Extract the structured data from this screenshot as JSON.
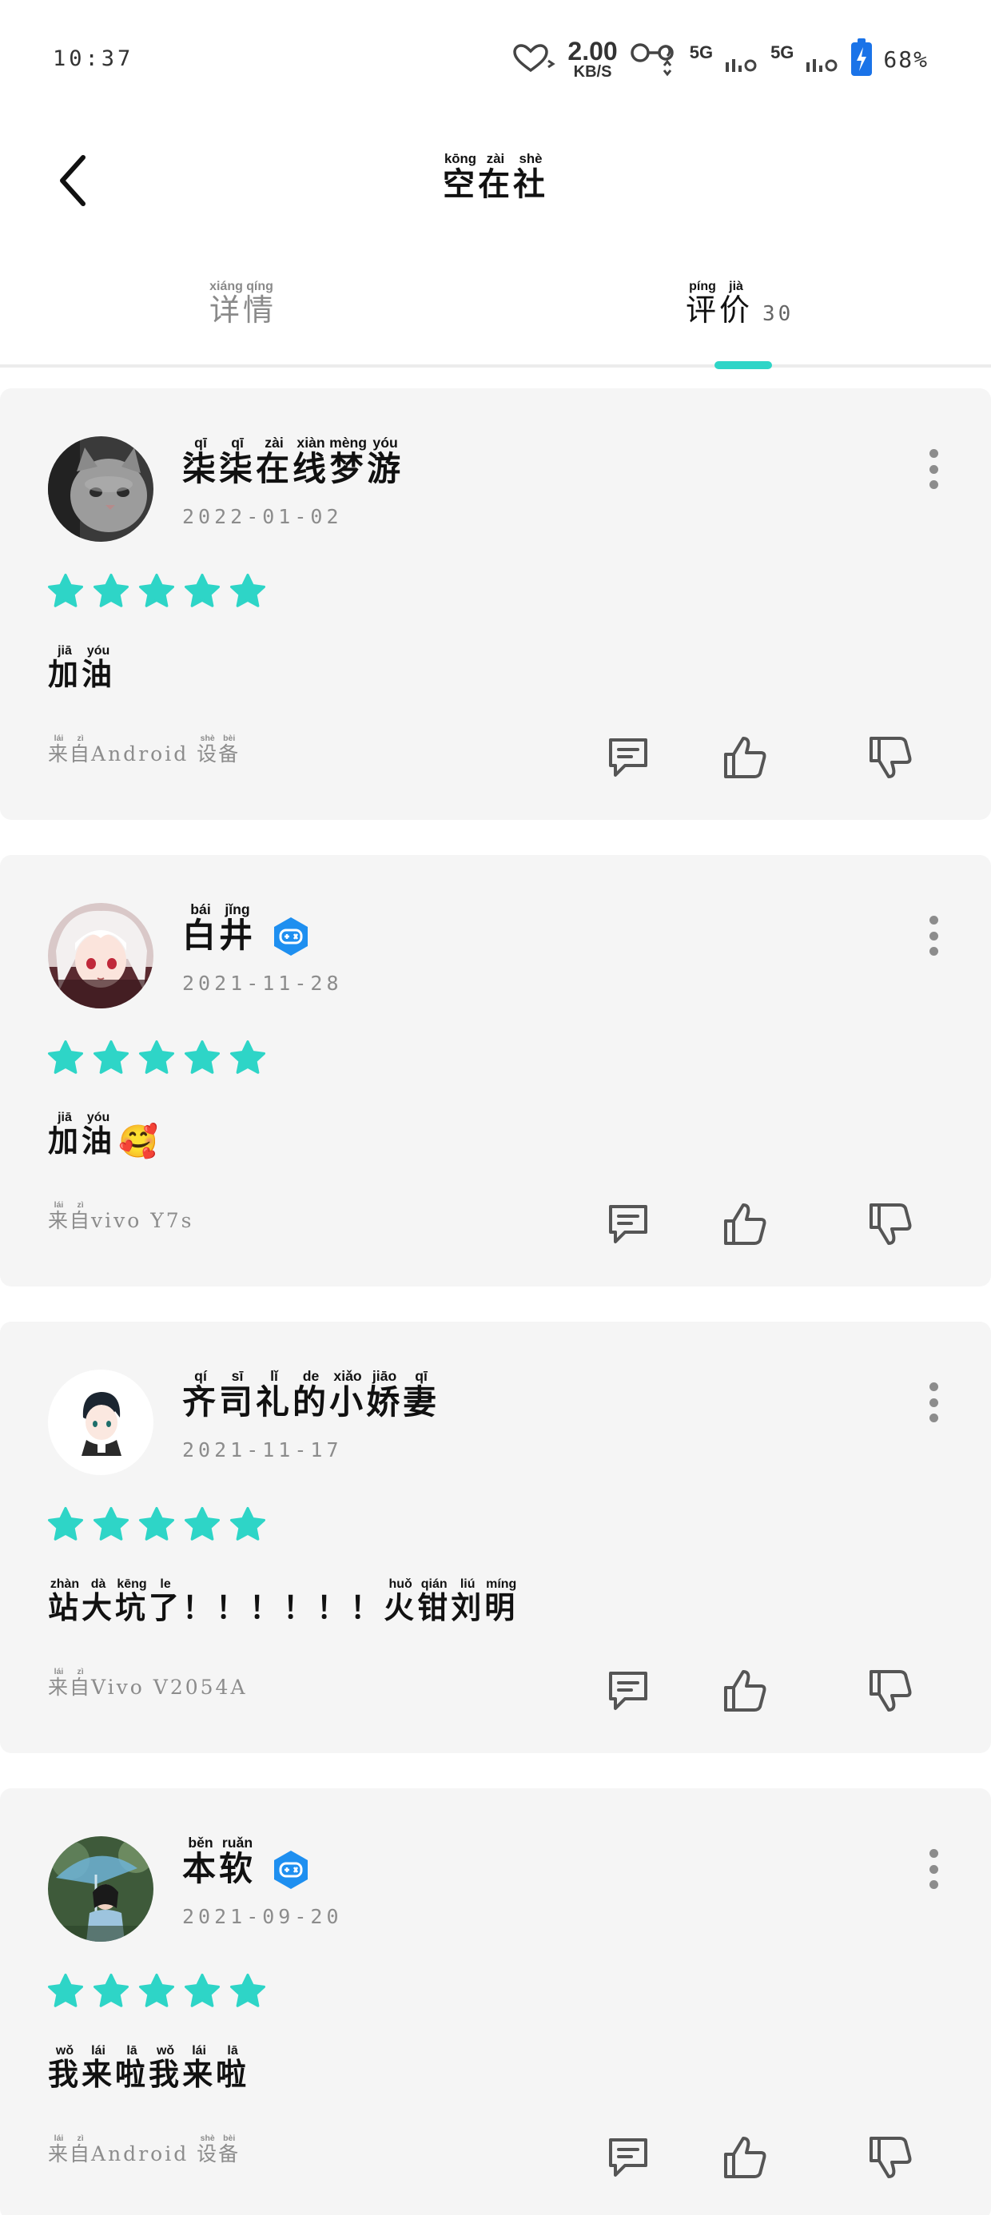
{
  "status_bar": {
    "time": "10:37",
    "speed_value": "2.00",
    "speed_unit": "KB/S",
    "net1": "5G",
    "net2": "5G",
    "battery": "68%"
  },
  "header": {
    "back_icon": "chevron-left-icon",
    "title": [
      {
        "ch": "空",
        "py": "kōng"
      },
      {
        "ch": "在",
        "py": "zài"
      },
      {
        "ch": "社",
        "py": "shè"
      }
    ]
  },
  "tabs": {
    "details": [
      {
        "ch": "详",
        "py": "xiáng"
      },
      {
        "ch": "情",
        "py": "qíng"
      }
    ],
    "reviews": [
      {
        "ch": "评",
        "py": "píng"
      },
      {
        "ch": "价",
        "py": "jià"
      }
    ],
    "review_count": "30",
    "active": "reviews",
    "accent_color": "#2ed5c7"
  },
  "reviews": [
    {
      "username": [
        {
          "ch": "柒",
          "py": "qī"
        },
        {
          "ch": "柒",
          "py": "qī"
        },
        {
          "ch": "在",
          "py": "zài"
        },
        {
          "ch": "线",
          "py": "xiàn"
        },
        {
          "ch": "梦",
          "py": "mèng"
        },
        {
          "ch": "游",
          "py": "yóu"
        }
      ],
      "badge": false,
      "avatar": "gray-kitten",
      "date": "2022-01-02",
      "rating": 5,
      "content": [
        {
          "ch": "加",
          "py": "jiā"
        },
        {
          "ch": "油",
          "py": "yóu"
        }
      ],
      "device_prefix": [
        {
          "ch": "来",
          "py": "lái"
        },
        {
          "ch": "自",
          "py": "zì"
        }
      ],
      "device_name": "Android",
      "device_suffix": [
        {
          "ch": "设",
          "py": "shè"
        },
        {
          "ch": "备",
          "py": "bèi"
        }
      ]
    },
    {
      "username": [
        {
          "ch": "白",
          "py": "bái"
        },
        {
          "ch": "井",
          "py": "jǐng"
        }
      ],
      "badge": true,
      "avatar": "anime-white-hair",
      "date": "2021-11-28",
      "rating": 5,
      "content": [
        {
          "ch": "加",
          "py": "jiā"
        },
        {
          "ch": "油",
          "py": "yóu"
        }
      ],
      "emoji": "🥰",
      "device_prefix": [
        {
          "ch": "来",
          "py": "lái"
        },
        {
          "ch": "自",
          "py": "zì"
        }
      ],
      "device_name": "vivo Y7s",
      "device_suffix": []
    },
    {
      "username": [
        {
          "ch": "齐",
          "py": "qí"
        },
        {
          "ch": "司",
          "py": "sī"
        },
        {
          "ch": "礼",
          "py": "lǐ"
        },
        {
          "ch": "的",
          "py": "de"
        },
        {
          "ch": "小",
          "py": "xiǎo"
        },
        {
          "ch": "娇",
          "py": "jiāo"
        },
        {
          "ch": "妻",
          "py": "qī"
        }
      ],
      "badge": false,
      "avatar": "anime-dark-hair",
      "date": "2021-11-17",
      "rating": 5,
      "content": [
        {
          "ch": "站",
          "py": "zhàn"
        },
        {
          "ch": "大",
          "py": "dà"
        },
        {
          "ch": "坑",
          "py": "kēng"
        },
        {
          "ch": "了",
          "py": "le"
        },
        {
          "ch": "！",
          "py": ""
        },
        {
          "ch": "！",
          "py": ""
        },
        {
          "ch": "！",
          "py": ""
        },
        {
          "ch": "！",
          "py": ""
        },
        {
          "ch": "！",
          "py": ""
        },
        {
          "ch": "！",
          "py": ""
        },
        {
          "ch": "火",
          "py": "huǒ"
        },
        {
          "ch": "钳",
          "py": "qián"
        },
        {
          "ch": "刘",
          "py": "liú"
        },
        {
          "ch": "明",
          "py": "míng"
        }
      ],
      "device_prefix": [
        {
          "ch": "来",
          "py": "lái"
        },
        {
          "ch": "自",
          "py": "zì"
        }
      ],
      "device_name": "Vivo V2054A",
      "device_suffix": []
    },
    {
      "username": [
        {
          "ch": "本",
          "py": "běn"
        },
        {
          "ch": "软",
          "py": "ruǎn"
        }
      ],
      "badge": true,
      "avatar": "girl-umbrella",
      "date": "2021-09-20",
      "rating": 5,
      "content": [
        {
          "ch": "我",
          "py": "wǒ"
        },
        {
          "ch": "来",
          "py": "lái"
        },
        {
          "ch": "啦",
          "py": "lā"
        },
        {
          "ch": "我",
          "py": "wǒ"
        },
        {
          "ch": "来",
          "py": "lái"
        },
        {
          "ch": "啦",
          "py": "lā"
        }
      ],
      "device_prefix": [
        {
          "ch": "来",
          "py": "lái"
        },
        {
          "ch": "自",
          "py": "zì"
        }
      ],
      "device_name": "Android",
      "device_suffix": [
        {
          "ch": "设",
          "py": "shè"
        },
        {
          "ch": "备",
          "py": "bèi"
        }
      ]
    }
  ],
  "colors": {
    "star": "#2ed5c7",
    "badge": "#1e8ff0",
    "card_bg": "#f5f5f5",
    "muted_text": "#8c8c8c"
  }
}
